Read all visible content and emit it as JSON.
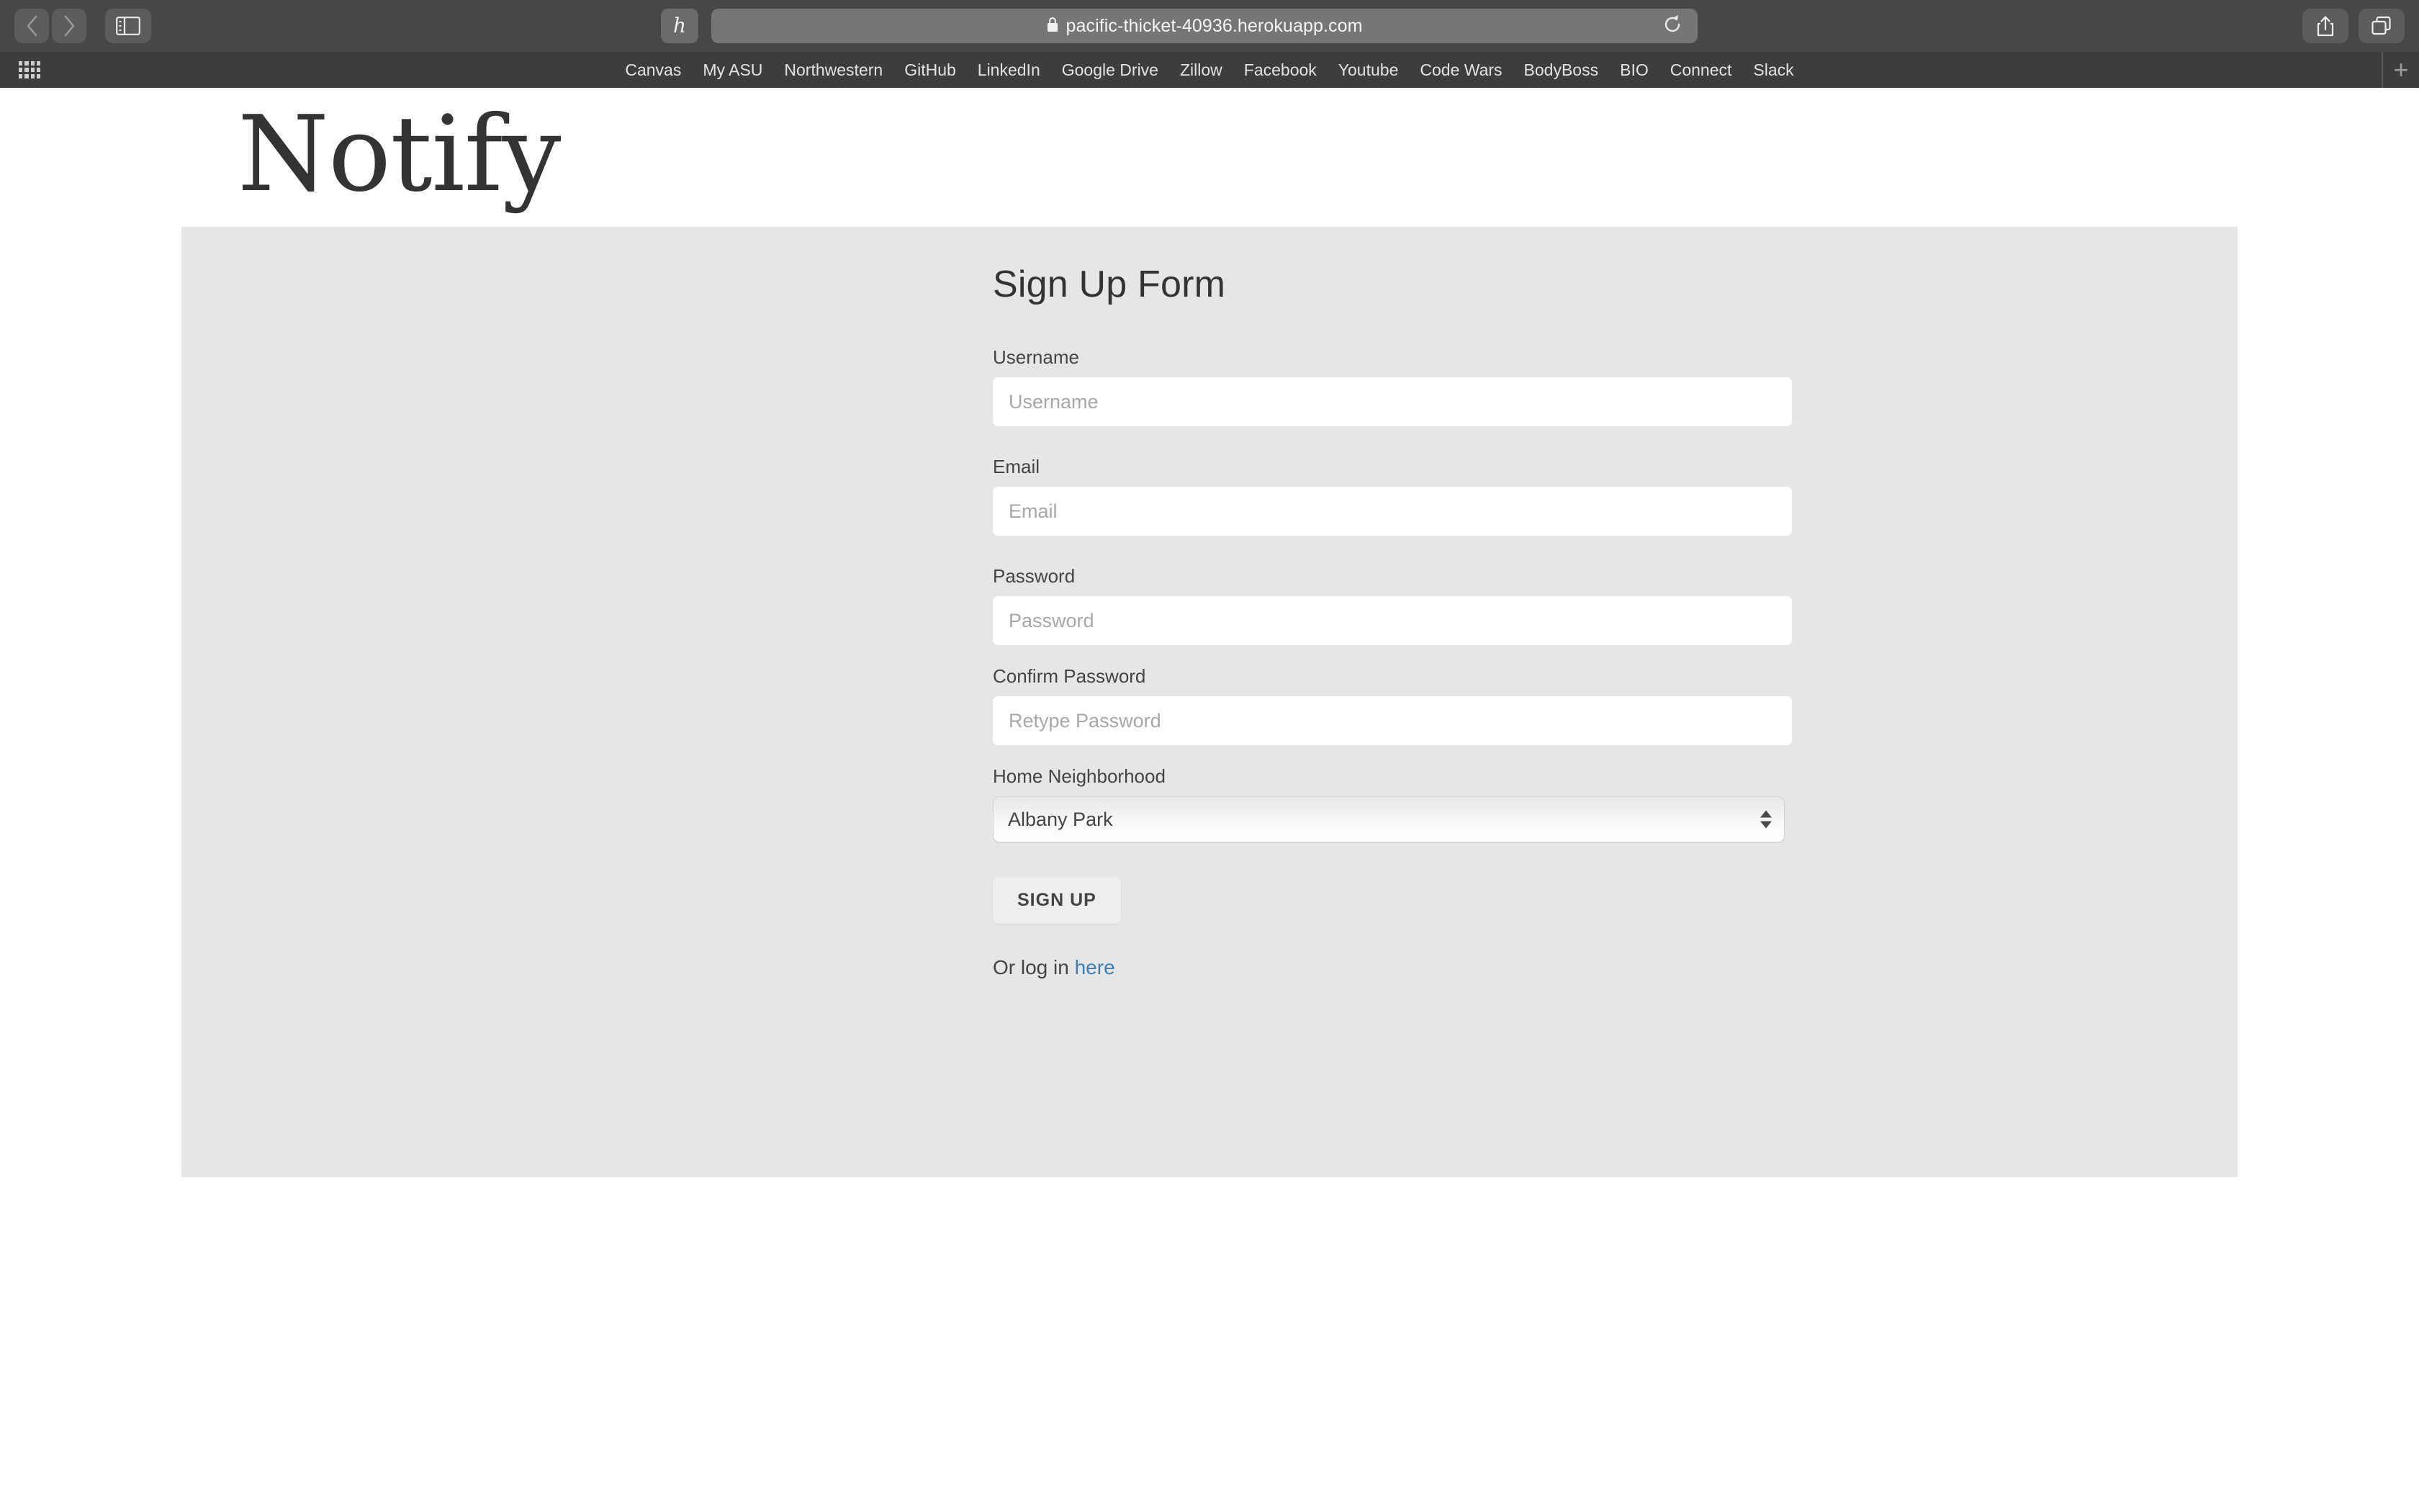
{
  "browser": {
    "back_icon": "chevron-left-icon",
    "forward_icon": "chevron-right-icon",
    "sidebar_icon": "sidebar-toggle-icon",
    "extension_glyph": "h",
    "lock_icon": "lock-icon",
    "url": "pacific-thicket-40936.herokuapp.com",
    "reload_icon": "reload-icon",
    "share_icon": "share-icon",
    "tabs_icon": "tab-overview-icon",
    "apps_grid_icon": "apps-grid-icon",
    "new_tab_label": "+"
  },
  "bookmarks": [
    {
      "label": "Canvas"
    },
    {
      "label": "My ASU"
    },
    {
      "label": "Northwestern"
    },
    {
      "label": "GitHub"
    },
    {
      "label": "LinkedIn"
    },
    {
      "label": "Google Drive"
    },
    {
      "label": "Zillow"
    },
    {
      "label": "Facebook"
    },
    {
      "label": "Youtube"
    },
    {
      "label": "Code Wars"
    },
    {
      "label": "BodyBoss"
    },
    {
      "label": "BIO"
    },
    {
      "label": "Connect"
    },
    {
      "label": "Slack"
    }
  ],
  "site": {
    "brand": "Notify",
    "panel_bg": "#e6e6e6",
    "link_color": "#3d7eb5"
  },
  "form": {
    "title": "Sign Up Form",
    "fields": [
      {
        "label": "Username",
        "placeholder": "Username",
        "value": "",
        "type": "text"
      },
      {
        "label": "Email",
        "placeholder": "Email",
        "value": "",
        "type": "text"
      },
      {
        "label": "Password",
        "placeholder": "Password",
        "value": "",
        "type": "password"
      },
      {
        "label": "Confirm Password",
        "placeholder": "Retype Password",
        "value": "",
        "type": "password"
      }
    ],
    "neighborhood": {
      "label": "Home Neighborhood",
      "selected": "Albany Park"
    },
    "submit_label": "SIGN UP",
    "login_prompt": "Or log in ",
    "login_link_label": "here"
  }
}
